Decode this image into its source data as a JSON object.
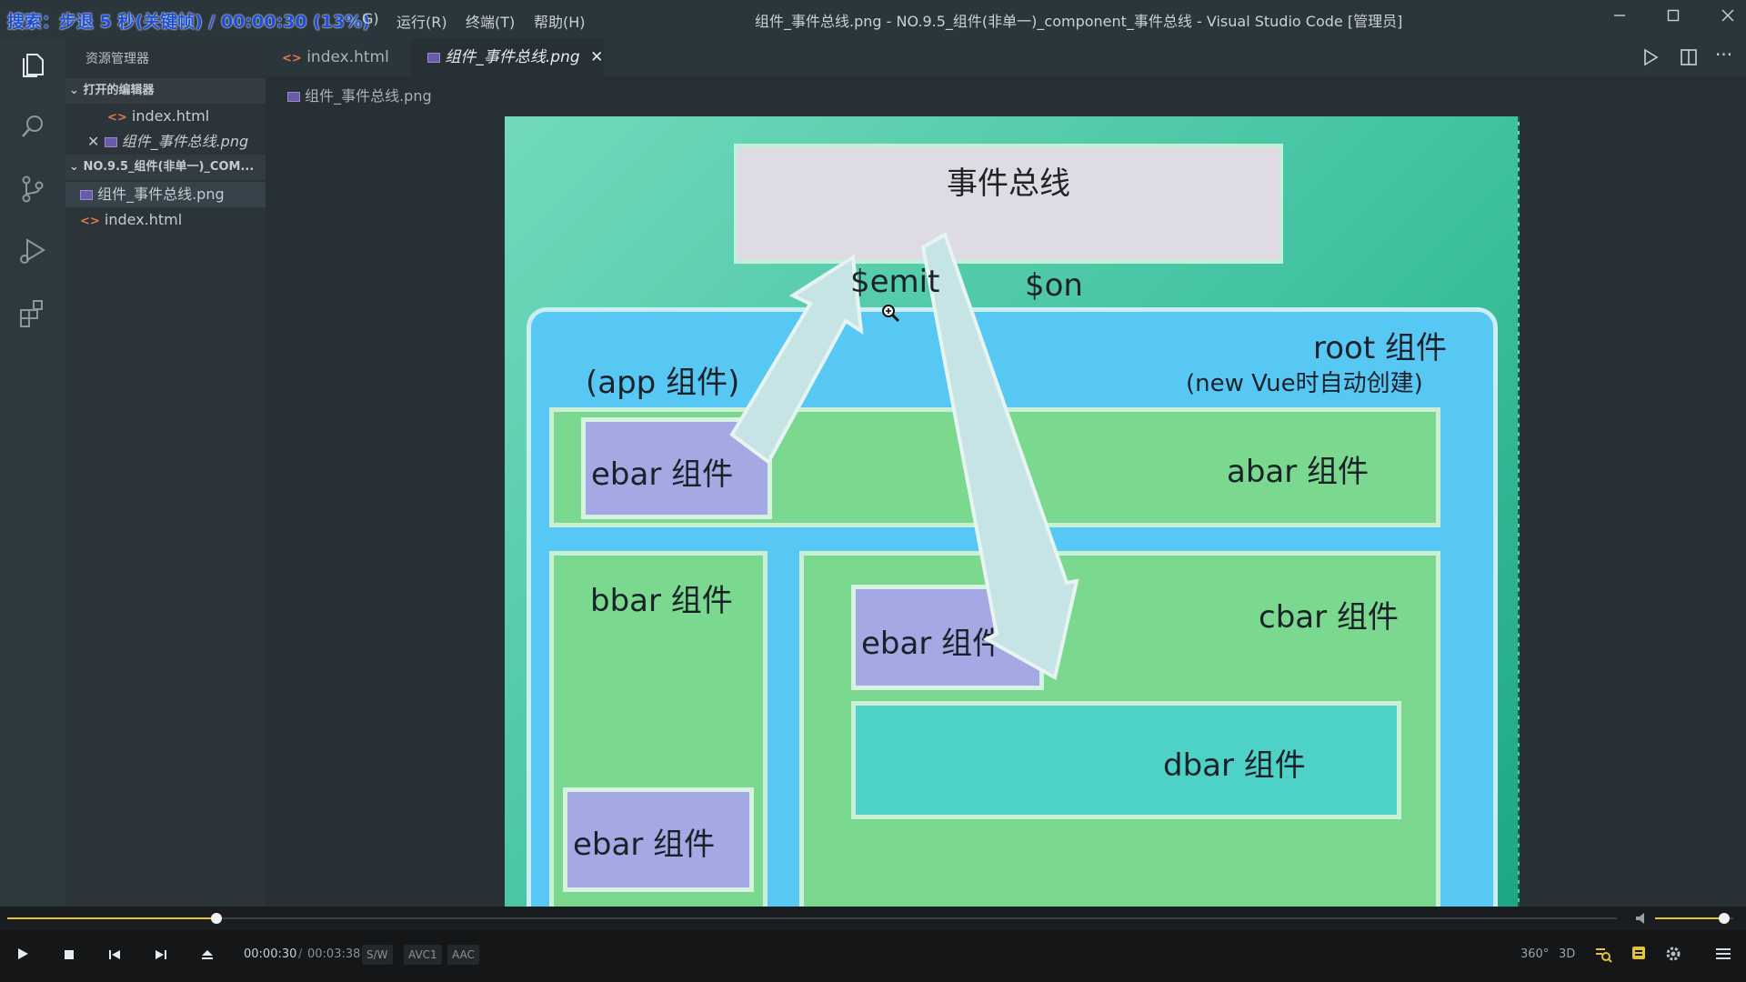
{
  "titlebar": {
    "osd_text": "搜索：步退 5 秒(关键帧) / 00:00:30 (13%)",
    "menu_G": "G)",
    "menu_run": "运行(R)",
    "menu_terminal": "终端(T)",
    "menu_help": "帮助(H)",
    "window_title": "组件_事件总线.png - NO.9.5_组件(非单一)_component_事件总线 - Visual Studio Code [管理员]",
    "minimize_icon": "minimize-icon",
    "maximize_icon": "maximize-icon",
    "close_icon": "close-icon"
  },
  "activity_bar": {
    "items": [
      "files-icon",
      "search-icon",
      "source-control-icon",
      "run-debug-icon",
      "extensions-icon"
    ]
  },
  "sidebar": {
    "title": "资源管理器",
    "open_editors_title": "打开的编辑器",
    "open_editors": [
      "index.html",
      "组件_事件总线.png"
    ],
    "project_title": "NO.9.5_组件(非单一)_COM...",
    "files": [
      "组件_事件总线.png",
      "index.html"
    ]
  },
  "tabs": [
    {
      "label": "index.html",
      "active": false
    },
    {
      "label": "组件_事件总线.png",
      "active": true
    }
  ],
  "breadcrumb": "组件_事件总线.png",
  "diagram": {
    "bus": "事件总线",
    "emit": "$emit",
    "on": "$on",
    "root": "root 组件",
    "root_note": "(new Vue时自动创建)",
    "app": "(app 组件)",
    "abar": "abar 组件",
    "bbar": "bbar 组件",
    "cbar": "cbar 组件",
    "dbar": "dbar 组件",
    "ebar": "ebar 组件"
  },
  "player": {
    "progress": 0.13,
    "current_time": "00:00:30",
    "separator": "/",
    "total_time": "00:03:38",
    "badges": [
      "S/W",
      "AVC1",
      "AAC"
    ],
    "right_labels": [
      "360°",
      "3D"
    ],
    "volume": 0.88
  }
}
